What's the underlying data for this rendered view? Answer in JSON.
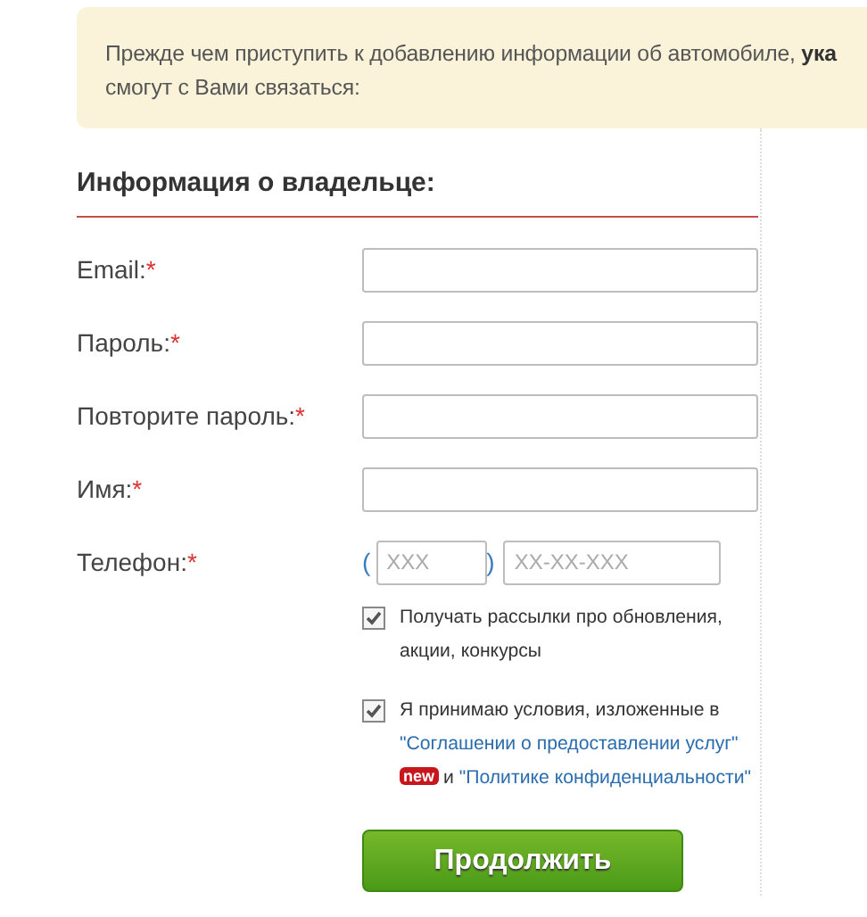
{
  "notice": {
    "text": "Прежде чем приступить к добавлению информации об автомобиле, **ука**",
    "text_line_2": "смогут с Вами связаться:"
  },
  "section": {
    "title": "Информация о владельце:"
  },
  "fields": [
    {
      "label": "Email:",
      "required_mark": "*",
      "kind": "text"
    },
    {
      "label": "Пароль:",
      "required_mark": "*",
      "kind": "text"
    },
    {
      "label": "Повторите пароль:",
      "required_mark": "*",
      "kind": "text"
    },
    {
      "label": "Имя:",
      "required_mark": "*",
      "kind": "text"
    },
    {
      "label": "Телефон:",
      "required_mark": "*",
      "kind": "phone",
      "open_paren": "(",
      "code_placeholder": "XXX",
      "close_paren": ")",
      "number_placeholder": "XX-XX-XXX"
    }
  ],
  "checkboxes": [
    {
      "kind": "plain",
      "checked": true,
      "text": "Получать рассылки про обновления, акции, конкурсы"
    },
    {
      "kind": "terms",
      "checked": true,
      "text": "Я принимаю условия, изложенные в",
      "link_1": "\"Соглашении о предоставлении услуг\"",
      "badge": "new",
      "conjunction": "и",
      "link_2": "\"Политике конфиденциальности\""
    }
  ],
  "submit": {
    "label": "Продолжить"
  }
}
